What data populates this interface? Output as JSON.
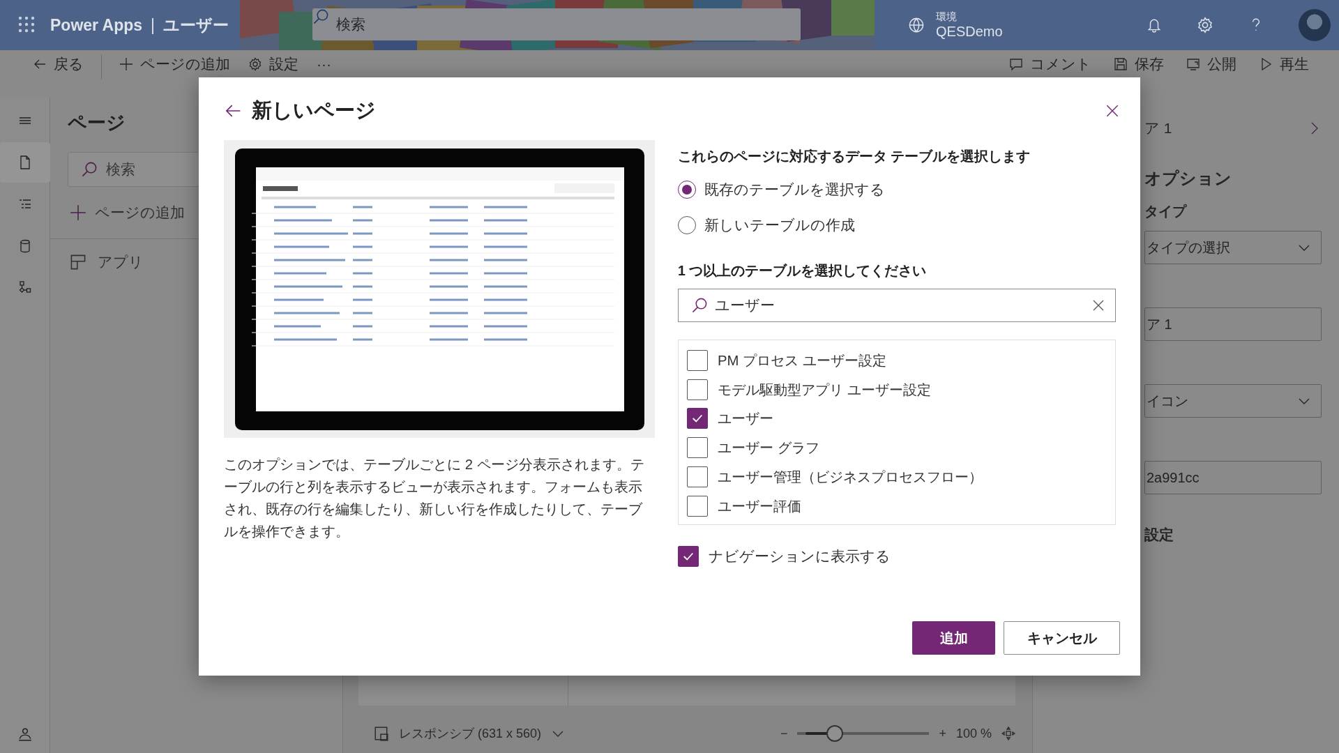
{
  "header": {
    "app_name": "Power Apps",
    "separator": "|",
    "app_title": "ユーザー",
    "search": {
      "placeholder": "検索"
    },
    "environment_label": "環境",
    "environment_name": "QESDemo"
  },
  "command_bar": {
    "left": [
      {
        "kind": "back",
        "label": "戻る"
      },
      {
        "kind": "add",
        "label": "ページの追加"
      },
      {
        "kind": "settings",
        "label": "設定"
      },
      {
        "kind": "more",
        "label": "···"
      }
    ],
    "right": [
      {
        "kind": "comment",
        "label": "コメント"
      },
      {
        "kind": "save",
        "label": "保存"
      },
      {
        "kind": "publish",
        "label": "公開"
      },
      {
        "kind": "play",
        "label": "再生"
      }
    ]
  },
  "rail": [
    {
      "kind": "menu",
      "selected": false
    },
    {
      "kind": "page",
      "selected": true
    },
    {
      "kind": "list",
      "selected": false
    },
    {
      "kind": "data",
      "selected": false
    },
    {
      "kind": "flow",
      "selected": false
    }
  ],
  "pages_panel": {
    "title": "ページ",
    "search": {
      "placeholder": "検索"
    },
    "add_label": "ページの追加",
    "items": [
      {
        "label": "アプリ"
      }
    ]
  },
  "right_panel": {
    "title": "ア 1",
    "section": "オプション",
    "type_label": "タイプ",
    "fields": [
      {
        "kind": "dropdown",
        "value": "タイプの選択"
      },
      {
        "kind": "text",
        "value": "ア 1"
      },
      {
        "kind": "dropdown",
        "value": "イコン"
      },
      {
        "kind": "text",
        "value": "2a991cc"
      }
    ],
    "footer_heading": "設定"
  },
  "status_bar": {
    "layout": "レスポンシブ (631 x 560)",
    "zoom_minus": "−",
    "zoom_plus": "+",
    "zoom": {
      "level": 0.22
    },
    "zoom_text": "100 %"
  },
  "dialog": {
    "title": "新しいページ",
    "description": "このオプションでは、テーブルごとに 2 ページ分表示されます。テーブルの行と列を表示するビューが表示されます。フォームも表示され、既存の行を編集したり、新しい行を作成したりして、テーブルを操作できます。",
    "heading": "これらのページに対応するデータ テーブルを選択します",
    "options": [
      {
        "label": "既存のテーブルを選択する",
        "selected": true
      },
      {
        "label": "新しいテーブルの作成",
        "selected": false
      }
    ],
    "tables_label": "1 つ以上のテーブルを選択してください",
    "search": {
      "value": "ユーザー"
    },
    "tables": [
      {
        "label": "PM プロセス ユーザー設定",
        "checked": false
      },
      {
        "label": "モデル駆動型アプリ ユーザー設定",
        "checked": false
      },
      {
        "label": "ユーザー",
        "checked": true
      },
      {
        "label": "ユーザー グラフ",
        "checked": false
      },
      {
        "label": "ユーザー管理（ビジネスプロセスフロー）",
        "checked": false
      },
      {
        "label": "ユーザー評価",
        "checked": false
      }
    ],
    "show_in_navigation": {
      "label": "ナビゲーションに表示する",
      "checked": true
    },
    "buttons": [
      {
        "kind": "primary",
        "label": "追加"
      },
      {
        "kind": "secondary",
        "label": "キャンセル"
      }
    ]
  }
}
